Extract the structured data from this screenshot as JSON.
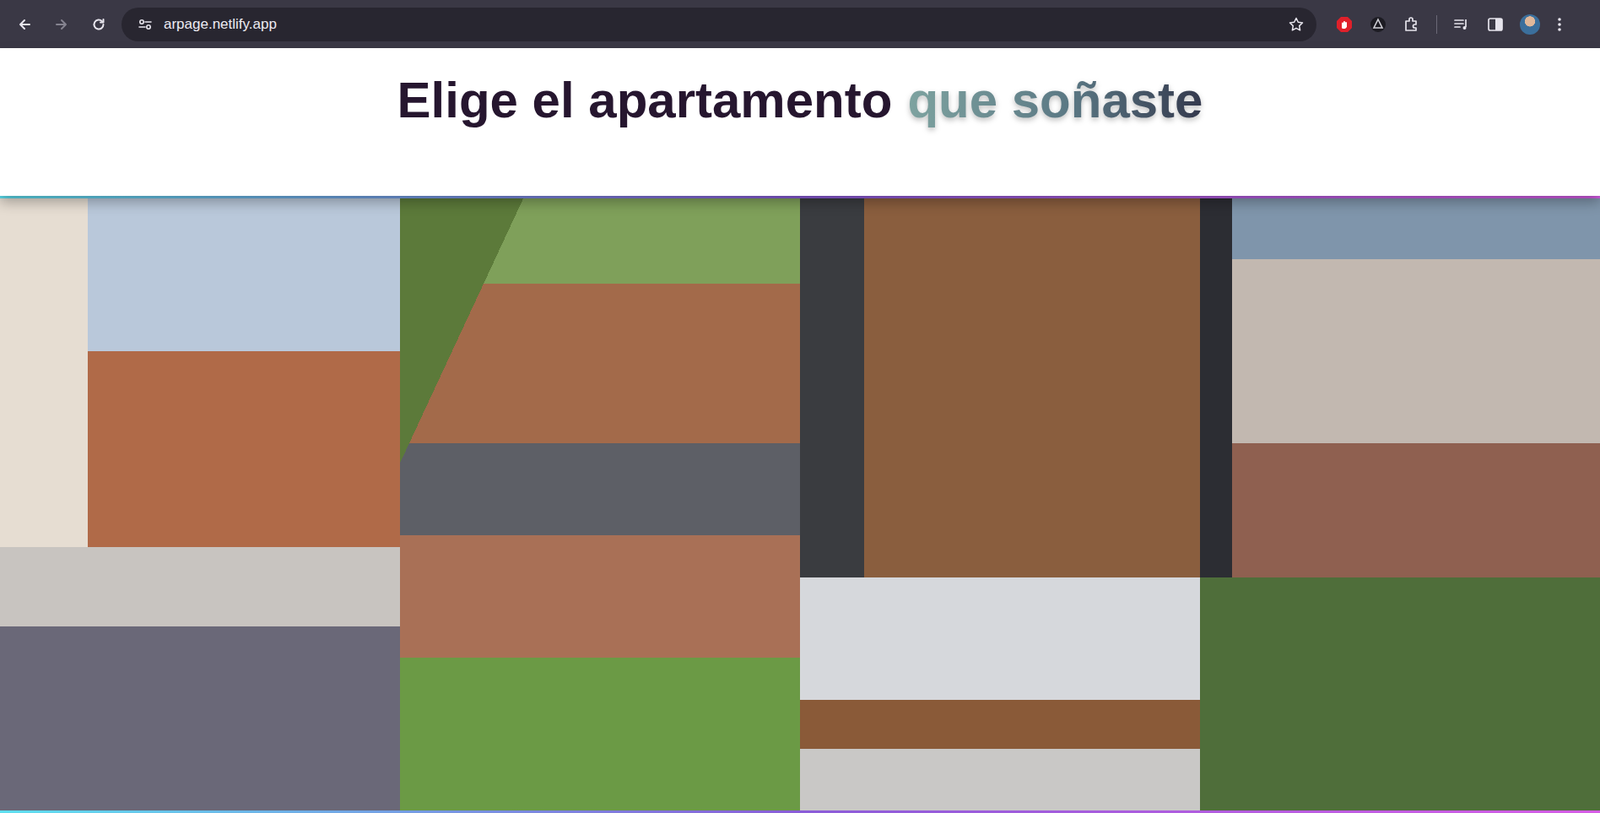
{
  "browser": {
    "url": "arpage.netlify.app",
    "back": {
      "disabled": false
    },
    "forward": {
      "disabled": true
    },
    "bookmarked": false
  },
  "page": {
    "heading": {
      "plain": "Elige el apartamento",
      "highlight": "que soñaste"
    }
  }
}
